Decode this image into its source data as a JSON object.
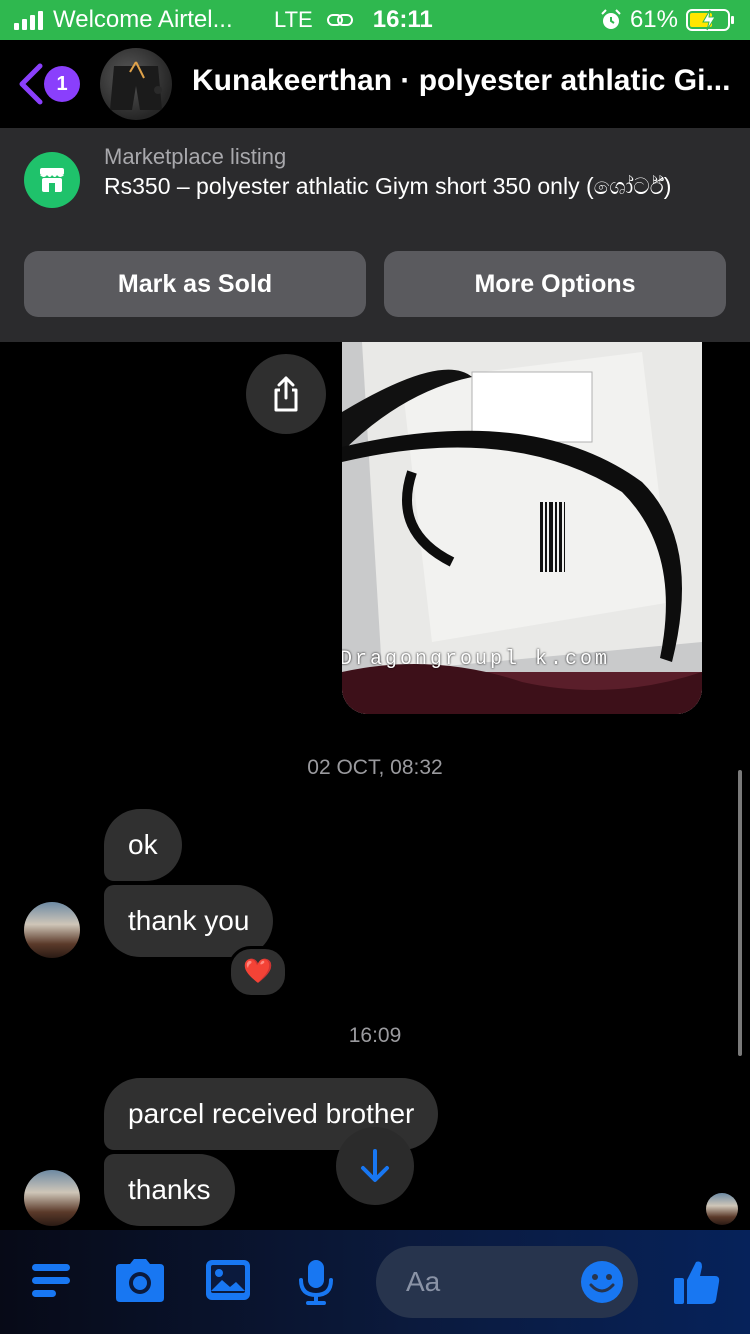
{
  "status_bar": {
    "carrier": "Welcome Airtel...",
    "network": "LTE",
    "time": "16:11",
    "battery": "61%",
    "battery_level": 0.61,
    "color": "#2fb84f"
  },
  "header": {
    "unread_count": "1",
    "title": "Kunakeerthan · polyester athlatic Gi..."
  },
  "marketplace": {
    "label": "Marketplace listing",
    "title": "Rs350 – polyester athlatic Giym short 350 only (ශෝර්ට්)",
    "mark_sold": "Mark as Sold",
    "more_options": "More Options",
    "accent": "#1fc26b"
  },
  "chat": {
    "photo_watermark": "www.Dragongroupl k.com",
    "timestamp_1": "02 OCT, 08:32",
    "msg_ok": "ok",
    "msg_thank_you": "thank you",
    "reaction": "❤️",
    "timestamp_2": "16:09",
    "msg_parcel": "parcel received brother",
    "msg_thanks": "thanks"
  },
  "composer": {
    "placeholder": "Aa",
    "accent": "#1877f2"
  }
}
